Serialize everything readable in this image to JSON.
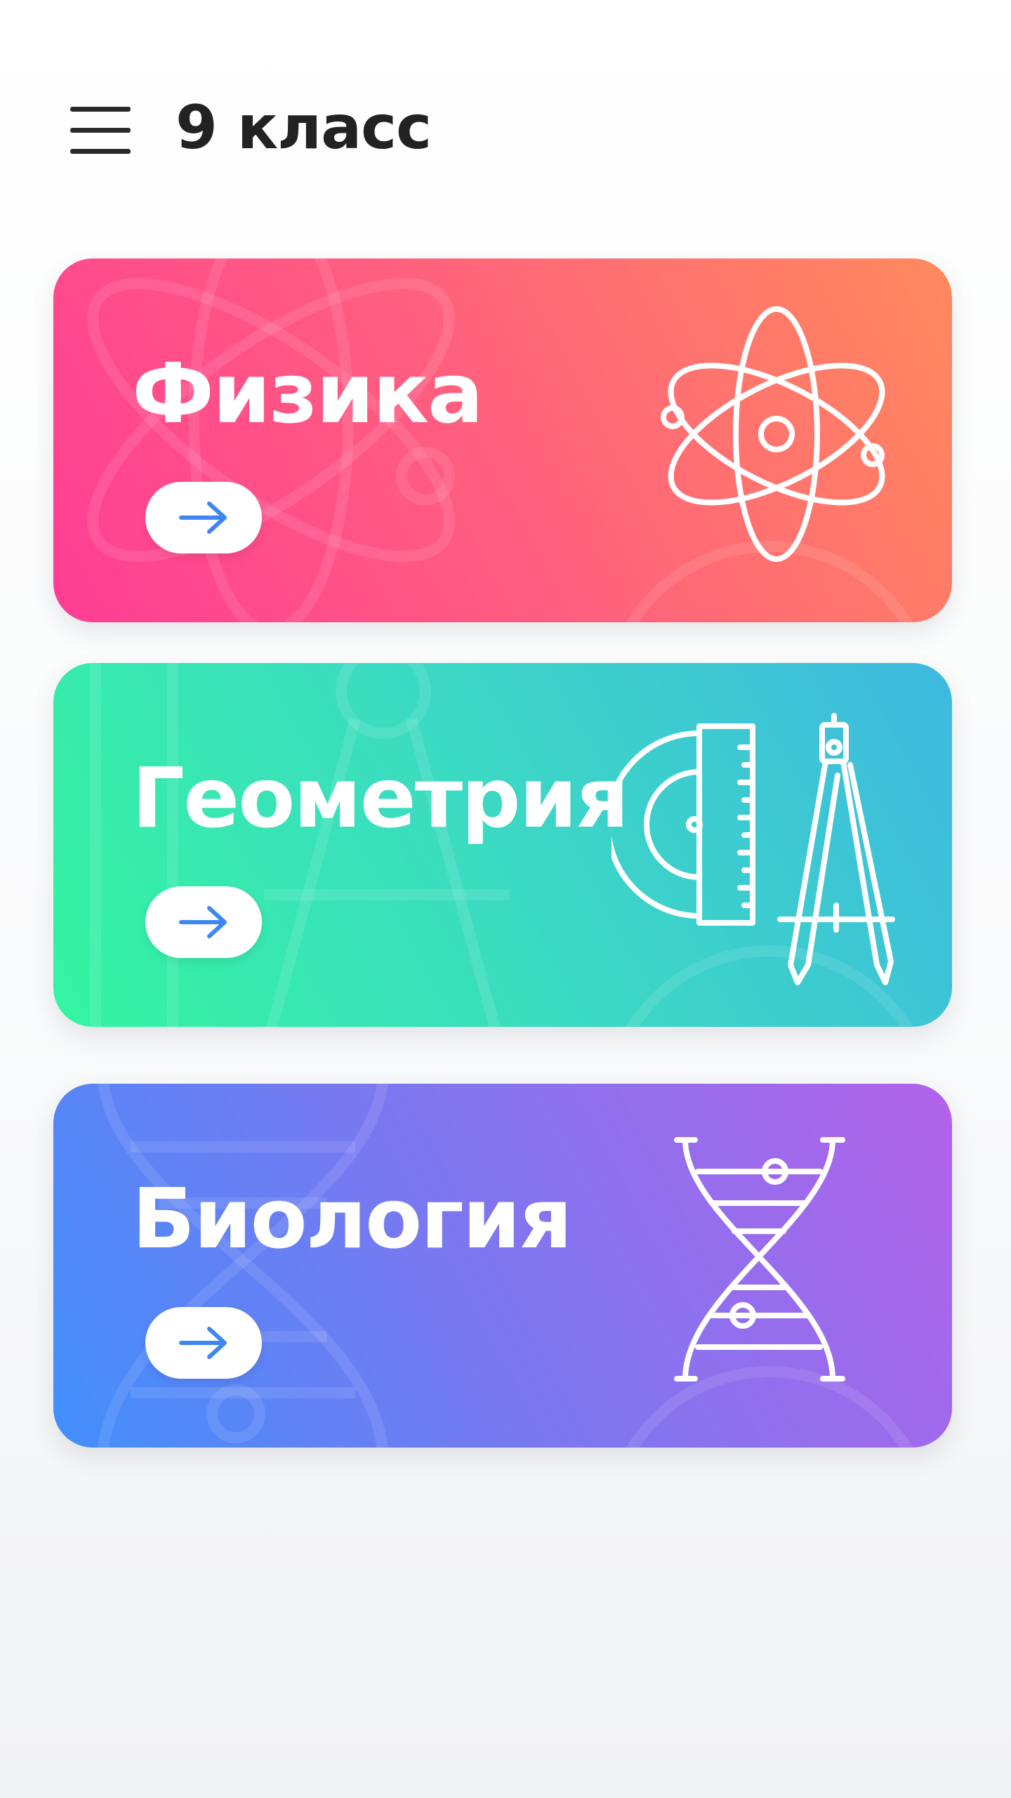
{
  "header": {
    "title": "9 класс",
    "menu_icon": "hamburger-menu-icon"
  },
  "subjects": [
    {
      "title": "Физика",
      "icon": "atom-icon",
      "action_icon": "arrow-right-icon",
      "gradient": [
        "#ff3d94",
        "#ff8a5c"
      ]
    },
    {
      "title": "Геометрия",
      "icon": "ruler-compass-icon",
      "action_icon": "arrow-right-icon",
      "gradient": [
        "#33f5a0",
        "#3eb9e0"
      ]
    },
    {
      "title": "Биология",
      "icon": "dna-icon",
      "action_icon": "arrow-right-icon",
      "gradient": [
        "#418ffc",
        "#b262ea"
      ]
    }
  ],
  "colors": {
    "arrow": "#3f86f5",
    "title_text": "#222222",
    "card_text": "#ffffff"
  }
}
